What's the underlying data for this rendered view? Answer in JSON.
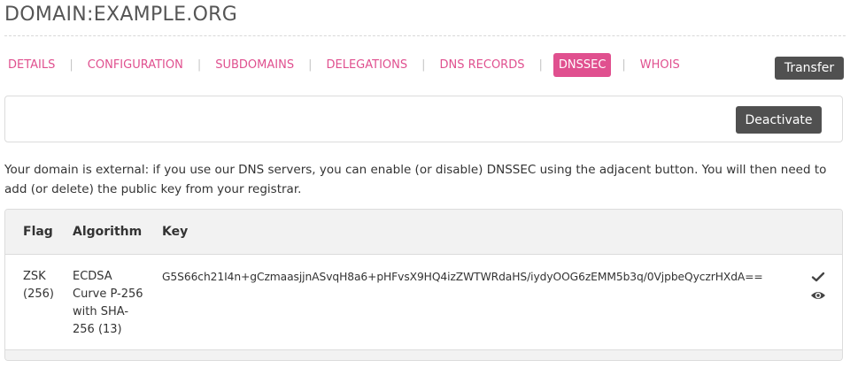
{
  "page": {
    "title": "DOMAIN:EXAMPLE.ORG"
  },
  "tabs": [
    {
      "label": "DETAILS",
      "active": false
    },
    {
      "label": "CONFIGURATION",
      "active": false
    },
    {
      "label": "SUBDOMAINS",
      "active": false
    },
    {
      "label": "DELEGATIONS",
      "active": false
    },
    {
      "label": "DNS RECORDS",
      "active": false
    },
    {
      "label": "DNSSEC",
      "active": true
    },
    {
      "label": "WHOIS",
      "active": false
    }
  ],
  "tab_separator": "|",
  "buttons": {
    "transfer": "Transfer",
    "deactivate": "Deactivate"
  },
  "info": {
    "text": "Your domain is external: if you use our DNS servers, you can enable (or disable) DNSSEC using the adjacent button. You will then need to add (or delete) the public key from your registrar."
  },
  "table": {
    "headers": {
      "flag": "Flag",
      "algorithm": "Algorithm",
      "key": "Key"
    },
    "rows": [
      {
        "flag": "ZSK (256)",
        "algorithm": "ECDSA Curve P-256 with SHA-256 (13)",
        "key": "G5S66ch21I4n+gCzmaasjjnASvqH8a6+pHFvsX9HQ4izZWTWRdaHS/iydyOOG6zEMM5b3q/0VjpbeQyczrHXdA==",
        "icons": [
          "check-icon",
          "eye-icon"
        ]
      }
    ]
  },
  "colors": {
    "accent": "#e0508f",
    "button": "#505050",
    "header_bg": "#f2f2f2",
    "border": "#dcdcdc"
  }
}
